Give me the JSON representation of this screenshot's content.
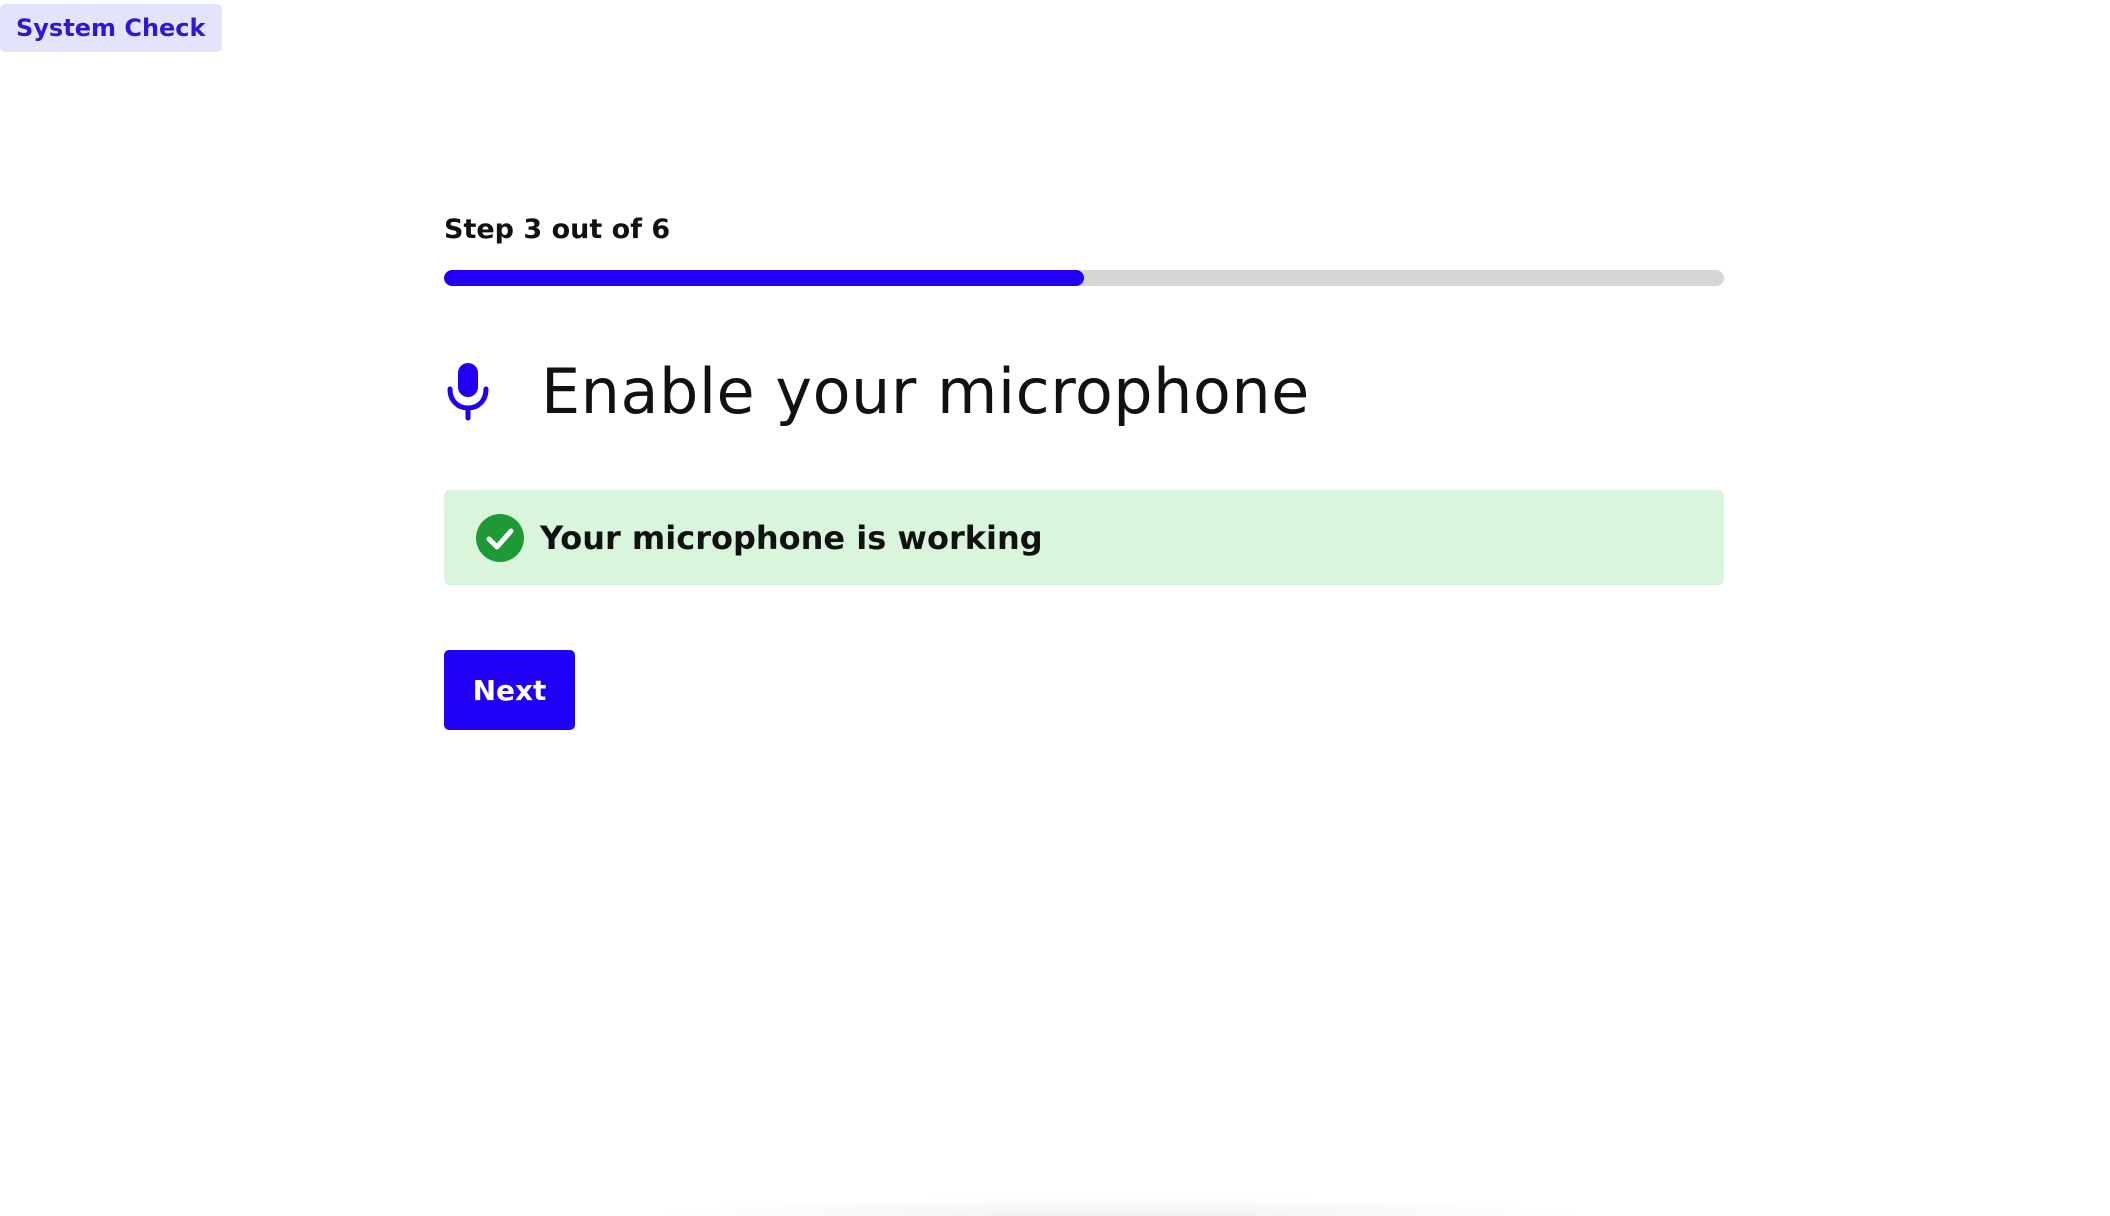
{
  "badge": {
    "label": "System Check"
  },
  "progress": {
    "label": "Step 3 out of 6",
    "current_step": 3,
    "total_steps": 6,
    "fraction": 0.5
  },
  "heading": {
    "icon": "microphone-icon",
    "text": "Enable your microphone"
  },
  "status": {
    "icon": "check-circle-icon",
    "text": "Your microphone is working",
    "background_color": "#d9f6dd",
    "icon_color": "#1e9a34"
  },
  "actions": {
    "next_label": "Next"
  },
  "colors": {
    "accent": "#1f00f5",
    "badge_background": "#e3e3fb",
    "badge_text": "#2d18d6",
    "progress_track": "#d6d6d6"
  }
}
